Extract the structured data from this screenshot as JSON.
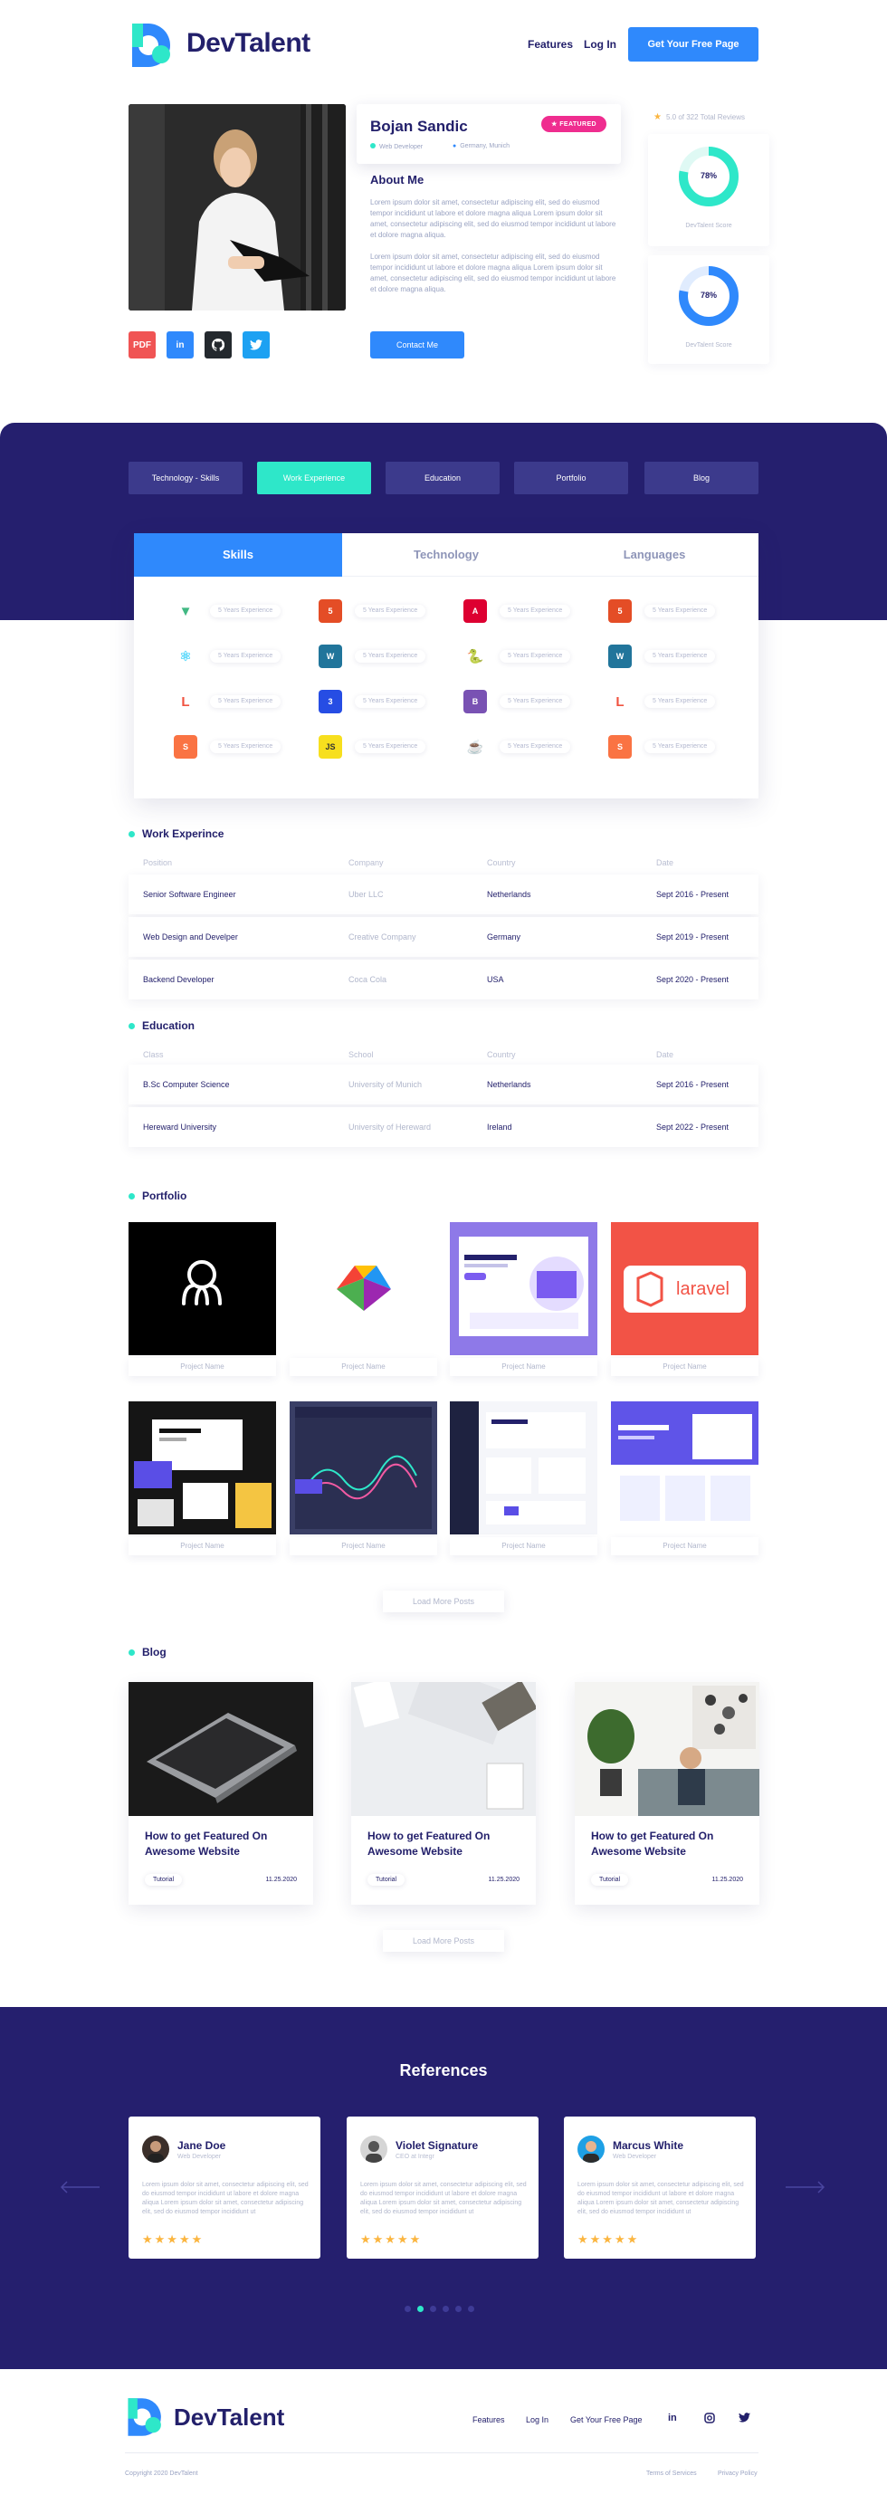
{
  "header": {
    "brand": "DevTalent",
    "nav": [
      "Features",
      "Log In"
    ],
    "cta": "Get Your Free Page"
  },
  "profile": {
    "name": "Bojan Sandic",
    "badge": "FEATURED",
    "role": "Web Developer",
    "location": "Germany, Munich",
    "about_title": "About Me",
    "about_p1": "Lorem ipsum dolor sit amet, consectetur adipiscing elit, sed do eiusmod tempor incididunt ut labore et dolore magna aliqua Lorem ipsum dolor sit amet, consectetur adipiscing elit, sed do eiusmod tempor incididunt ut labore et dolore magna aliqua.",
    "about_p2": "Lorem ipsum dolor sit amet, consectetur adipiscing elit, sed do eiusmod tempor incididunt ut labore et dolore magna aliqua Lorem ipsum dolor sit amet, consectetur adipiscing elit, sed do eiusmod tempor incididunt ut labore et dolore magna aliqua.",
    "contact": "Contact Me",
    "social": [
      "PDF",
      "in",
      "gh",
      "tw"
    ],
    "rating_text": "5.0 of 322 Total Reviews",
    "score1": {
      "value": "78%",
      "label": "DevTalent Score",
      "fraction": 0.78
    },
    "score2": {
      "value": "78%",
      "label": "DevTalent Score",
      "fraction": 0.78
    }
  },
  "tabs": [
    "Technology - Skills",
    "Work Experience",
    "Education",
    "Portfolio",
    "Blog"
  ],
  "skills": {
    "tabs": [
      "Skills",
      "Technology",
      "Languages"
    ],
    "experience_label": "5 Years Experience",
    "icons": [
      [
        "vue",
        "html5",
        "angular",
        "html5"
      ],
      [
        "react",
        "wordpress",
        "python",
        "wordpress"
      ],
      [
        "laravel",
        "css3",
        "bootstrap",
        "laravel"
      ],
      [
        "swift",
        "js",
        "java",
        "swift"
      ]
    ]
  },
  "work": {
    "title": "Work Experince",
    "headers": [
      "Position",
      "Company",
      "Country",
      "Date"
    ],
    "rows": [
      [
        "Senior Software Engineer",
        "Uber LLC",
        "Netherlands",
        "Sept 2016 - Present"
      ],
      [
        "Web Design and Develper",
        "Creative Company",
        "Germany",
        "Sept 2019 - Present"
      ],
      [
        "Backend Developer",
        "Coca Cola",
        "USA",
        "Sept 2020 - Present"
      ]
    ]
  },
  "education": {
    "title": "Education",
    "headers": [
      "Class",
      "School",
      "Country",
      "Date"
    ],
    "rows": [
      [
        "B.Sc Computer Science",
        "University of Munich",
        "Netherlands",
        "Sept 2016 - Present"
      ],
      [
        "Hereward University",
        "University of Hereward",
        "Ireland",
        "Sept 2022 - Present"
      ]
    ]
  },
  "portfolio": {
    "title": "Portfolio",
    "item_label": "Project Name",
    "laravel_word": "laravel",
    "load_more": "Load More Posts"
  },
  "blog": {
    "title": "Blog",
    "posts": [
      {
        "title": "How to get Featured On Awesome Website",
        "tag": "Tutorial",
        "date": "11.25.2020"
      },
      {
        "title": "How to get Featured On Awesome Website",
        "tag": "Tutorial",
        "date": "11.25.2020"
      },
      {
        "title": "How to get Featured On Awesome Website",
        "tag": "Tutorial",
        "date": "11.25.2020"
      }
    ],
    "load_more": "Load More Posts"
  },
  "references": {
    "title": "References",
    "items": [
      {
        "name": "Jane Doe",
        "role": "Web Developer",
        "text": "Lorem ipsum dolor sit amet, consectetur adipiscing elit, sed do eiusmod tempor incididunt ut labore et dolore magna aliqua Lorem ipsum dolor sit amet, consectetur adipiscing elit, sed do eiusmod tempor incididunt ut",
        "stars": "★★★★★"
      },
      {
        "name": "Violet Signature",
        "role": "CEO at Integr",
        "text": "Lorem ipsum dolor sit amet, consectetur adipiscing elit, sed do eiusmod tempor incididunt ut labore et dolore magna aliqua Lorem ipsum dolor sit amet, consectetur adipiscing elit, sed do eiusmod tempor incididunt ut",
        "stars": "★★★★★"
      },
      {
        "name": "Marcus White",
        "role": "Web Developer",
        "text": "Lorem ipsum dolor sit amet, consectetur adipiscing elit, sed do eiusmod tempor incididunt ut labore et dolore magna aliqua Lorem ipsum dolor sit amet, consectetur adipiscing elit, sed do eiusmod tempor incididunt ut",
        "stars": "★★★★★"
      }
    ]
  },
  "footer": {
    "brand": "DevTalent",
    "links": [
      "Features",
      "Log In",
      "Get Your Free Page"
    ],
    "copyright": "Copyright 2020 DevTalent",
    "terms": "Terms of Services",
    "privacy": "Privacy Policy"
  },
  "colors": {
    "navy": "#251f6e",
    "teal": "#2ee7c9",
    "blue": "#2f89fc",
    "pink": "#ef2d8f"
  }
}
